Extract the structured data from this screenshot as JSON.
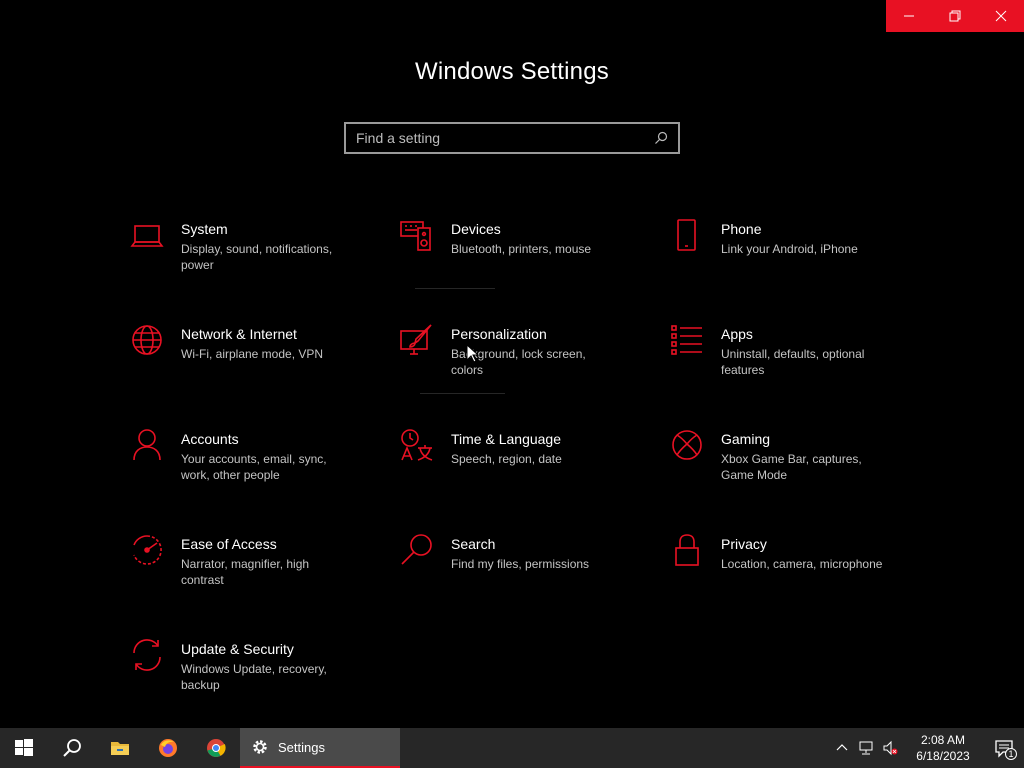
{
  "window": {
    "controls": [
      {
        "name": "minimize-button",
        "icon": "minimize-icon"
      },
      {
        "name": "restore-button",
        "icon": "restore-icon"
      },
      {
        "name": "close-button",
        "icon": "close-icon"
      }
    ],
    "control_color": "#e81123"
  },
  "header": {
    "title": "Windows Settings"
  },
  "search": {
    "placeholder": "Find a setting",
    "icon": "search-icon"
  },
  "accent": "#e81123",
  "tiles": [
    {
      "name": "System",
      "desc": "Display, sound, notifications, power",
      "icon": "laptop-icon"
    },
    {
      "name": "Devices",
      "desc": "Bluetooth, printers, mouse",
      "icon": "keyboard-speaker-icon"
    },
    {
      "name": "Phone",
      "desc": "Link your Android, iPhone",
      "icon": "phone-icon"
    },
    {
      "name": "Network & Internet",
      "desc": "Wi-Fi, airplane mode, VPN",
      "icon": "globe-icon"
    },
    {
      "name": "Personalization",
      "desc": "Background, lock screen, colors",
      "icon": "paint-brush-icon"
    },
    {
      "name": "Apps",
      "desc": "Uninstall, defaults, optional features",
      "icon": "apps-list-icon"
    },
    {
      "name": "Accounts",
      "desc": "Your accounts, email, sync, work, other people",
      "icon": "person-icon"
    },
    {
      "name": "Time & Language",
      "desc": "Speech, region, date",
      "icon": "time-language-icon"
    },
    {
      "name": "Gaming",
      "desc": "Xbox Game Bar, captures, Game Mode",
      "icon": "xbox-icon"
    },
    {
      "name": "Ease of Access",
      "desc": "Narrator, magnifier, high contrast",
      "icon": "ease-of-access-icon"
    },
    {
      "name": "Search",
      "desc": "Find my files, permissions",
      "icon": "magnifier-icon"
    },
    {
      "name": "Privacy",
      "desc": "Location, camera, microphone",
      "icon": "lock-icon"
    },
    {
      "name": "Update & Security",
      "desc": "Windows Update, recovery, backup",
      "icon": "sync-arrows-icon"
    }
  ],
  "taskbar": {
    "items": [
      {
        "name": "start-button",
        "icon": "windows-logo-icon"
      },
      {
        "name": "search-taskbar-button",
        "icon": "search-icon"
      },
      {
        "name": "file-explorer-button",
        "icon": "folder-icon"
      },
      {
        "name": "firefox-button",
        "icon": "firefox-icon"
      },
      {
        "name": "chrome-button",
        "icon": "chrome-icon"
      }
    ],
    "active_app": {
      "label": "Settings",
      "icon": "gear-icon"
    },
    "tray": {
      "icons": [
        "chevron-up-icon",
        "network-icon",
        "volume-muted-icon"
      ],
      "time": "2:08 AM",
      "date": "6/18/2023",
      "notifications_count": "1"
    }
  }
}
